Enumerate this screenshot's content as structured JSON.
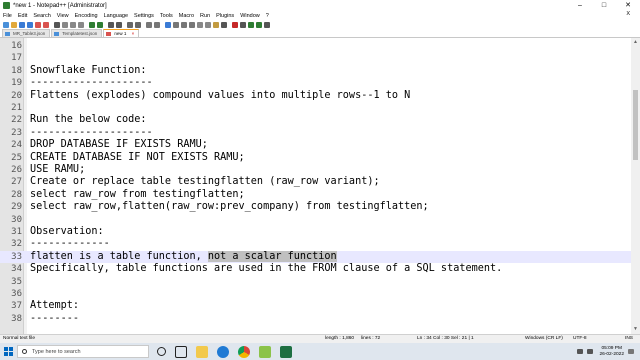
{
  "window": {
    "title": "*new 1 - Notepad++ [Administrator]",
    "controls": {
      "minimize": "–",
      "maximize": "□",
      "close": "✕"
    }
  },
  "menu": {
    "items": [
      "File",
      "Edit",
      "Search",
      "View",
      "Encoding",
      "Language",
      "Settings",
      "Tools",
      "Macro",
      "Run",
      "Plugins",
      "Window",
      "?"
    ],
    "close_label": "X"
  },
  "toolbar": {
    "icons": [
      "new-file-icon",
      "open-file-icon",
      "save-icon",
      "save-all-icon",
      "close-icon",
      "close-all-icon",
      "print-icon",
      "cut-icon",
      "copy-icon",
      "paste-icon",
      "undo-icon",
      "redo-icon",
      "find-icon",
      "replace-icon",
      "zoom-in-icon",
      "zoom-out-icon",
      "sync-v-icon",
      "sync-h-icon",
      "word-wrap-icon",
      "show-all-icon",
      "indent-guide-icon",
      "lang-icon",
      "doc-map-icon",
      "function-list-icon",
      "folder-workspace-icon",
      "monitor-icon",
      "record-macro-icon",
      "stop-macro-icon",
      "play-macro-icon",
      "run-macro-icon",
      "save-macro-icon"
    ]
  },
  "tabs": [
    {
      "label": "MR_Table3.json",
      "active": false
    },
    {
      "label": "Templatetest.json",
      "active": false
    },
    {
      "label": "new 1",
      "active": true
    }
  ],
  "editor": {
    "lines": [
      {
        "num": "16",
        "text": ""
      },
      {
        "num": "17",
        "text": ""
      },
      {
        "num": "18",
        "text": "Snowflake Function:"
      },
      {
        "num": "19",
        "text": "--------------------"
      },
      {
        "num": "20",
        "text": "Flattens (explodes) compound values into multiple rows--1 to N"
      },
      {
        "num": "21",
        "text": ""
      },
      {
        "num": "22",
        "text": "Run the below code:"
      },
      {
        "num": "23",
        "text": "--------------------"
      },
      {
        "num": "24",
        "text": "DROP DATABASE IF EXISTS RAMU;"
      },
      {
        "num": "25",
        "text": "CREATE DATABASE IF NOT EXISTS RAMU;"
      },
      {
        "num": "26",
        "text": "USE RAMU;"
      },
      {
        "num": "27",
        "text": "Create or replace table testingflatten (raw_row variant);"
      },
      {
        "num": "28",
        "text": "select raw_row from testingflatten;"
      },
      {
        "num": "29",
        "text": "select raw_row,flatten(raw_row:prev_company) from testingflatten;"
      },
      {
        "num": "30",
        "text": ""
      },
      {
        "num": "31",
        "text": "Observation:"
      },
      {
        "num": "32",
        "text": "-------------"
      },
      {
        "num": "33",
        "text": "flatten is a table function, ",
        "selected": "not a scalar function",
        "current": true
      },
      {
        "num": "34",
        "text": "Specifically, table functions are used in the FROM clause of a SQL statement."
      },
      {
        "num": "35",
        "text": ""
      },
      {
        "num": "36",
        "text": ""
      },
      {
        "num": "37",
        "text": "Attempt:"
      },
      {
        "num": "38",
        "text": "--------"
      }
    ]
  },
  "status": {
    "file_type": "Normal text file",
    "length": "length : 1,860",
    "lines": "lines : 72",
    "position": "Ln : 34   Col : 30   Sel : 21 | 1",
    "eol": "Windows (CR LF)",
    "encoding": "UTF-8",
    "mode": "INS"
  },
  "taskbar": {
    "search_placeholder": "Type here to search",
    "apps": [
      "cortana-icon",
      "task-view-icon",
      "file-explorer-icon",
      "edge-icon",
      "chrome-icon",
      "notepadpp-icon",
      "excel-icon"
    ],
    "time": "05:09 PM",
    "date": "26-02-2022"
  },
  "colors": {
    "selection": "#c0c0c0",
    "current_line": "#e8e8ff",
    "gutter": "#e4e4e4",
    "accent_tab": "#f7a21b"
  }
}
